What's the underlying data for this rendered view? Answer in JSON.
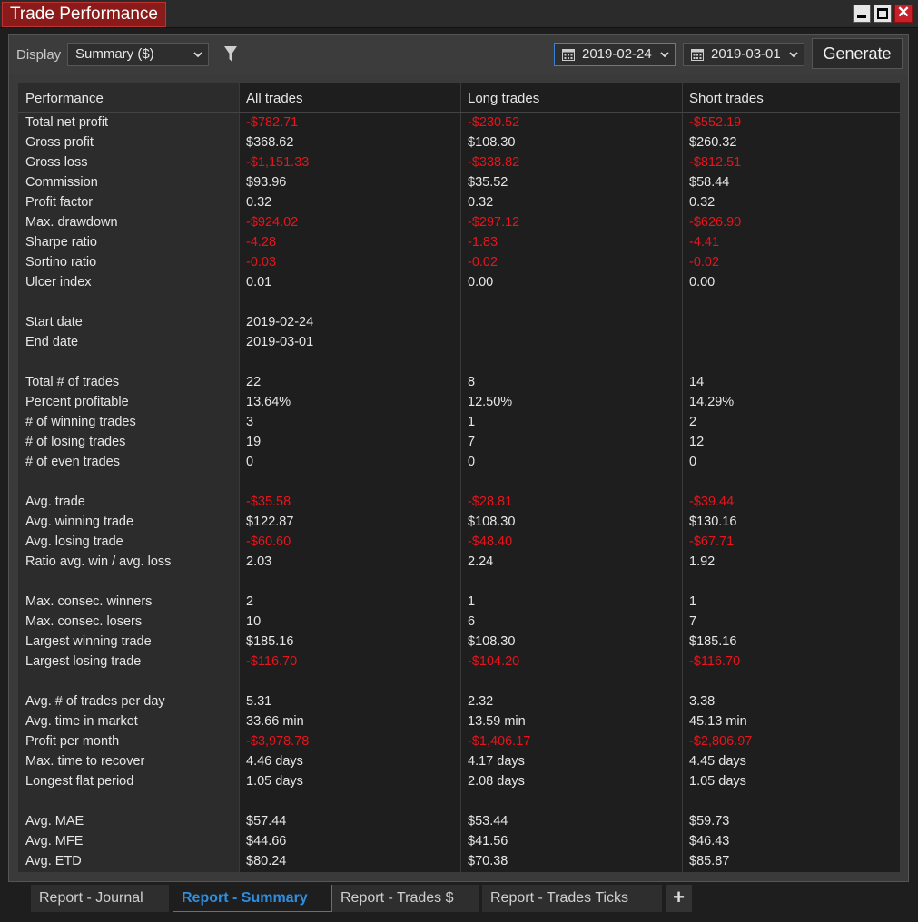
{
  "window": {
    "title": "Trade Performance"
  },
  "toolbar": {
    "display_label": "Display",
    "display_value": "Summary ($)",
    "start_date": "2019-02-24",
    "end_date": "2019-03-01",
    "generate_label": "Generate"
  },
  "table": {
    "headers": [
      "Performance",
      "All trades",
      "Long trades",
      "Short trades"
    ],
    "rows": [
      {
        "label": "Total net profit",
        "all": "-$782.71",
        "long": "-$230.52",
        "short": "-$552.19",
        "neg": true
      },
      {
        "label": "Gross profit",
        "all": "$368.62",
        "long": "$108.30",
        "short": "$260.32",
        "neg": false
      },
      {
        "label": "Gross loss",
        "all": "-$1,151.33",
        "long": "-$338.82",
        "short": "-$812.51",
        "neg": true
      },
      {
        "label": "Commission",
        "all": "$93.96",
        "long": "$35.52",
        "short": "$58.44",
        "neg": false
      },
      {
        "label": "Profit factor",
        "all": "0.32",
        "long": "0.32",
        "short": "0.32",
        "neg": false
      },
      {
        "label": "Max. drawdown",
        "all": "-$924.02",
        "long": "-$297.12",
        "short": "-$626.90",
        "neg": true
      },
      {
        "label": "Sharpe ratio",
        "all": "-4.28",
        "long": "-1.83",
        "short": "-4.41",
        "neg": true
      },
      {
        "label": "Sortino ratio",
        "all": "-0.03",
        "long": "-0.02",
        "short": "-0.02",
        "neg": true
      },
      {
        "label": "Ulcer index",
        "all": "0.01",
        "long": "0.00",
        "short": "0.00",
        "neg": false
      },
      {
        "spacer": true
      },
      {
        "label": "Start date",
        "all": "2019-02-24",
        "long": "",
        "short": "",
        "neg": false
      },
      {
        "label": "End date",
        "all": "2019-03-01",
        "long": "",
        "short": "",
        "neg": false
      },
      {
        "spacer": true
      },
      {
        "label": "Total # of trades",
        "all": "22",
        "long": "8",
        "short": "14",
        "neg": false
      },
      {
        "label": "Percent profitable",
        "all": "13.64%",
        "long": "12.50%",
        "short": "14.29%",
        "neg": false
      },
      {
        "label": "# of winning trades",
        "all": "3",
        "long": "1",
        "short": "2",
        "neg": false
      },
      {
        "label": "# of losing trades",
        "all": "19",
        "long": "7",
        "short": "12",
        "neg": false
      },
      {
        "label": "# of even trades",
        "all": "0",
        "long": "0",
        "short": "0",
        "neg": false
      },
      {
        "spacer": true
      },
      {
        "label": "Avg. trade",
        "all": "-$35.58",
        "long": "-$28.81",
        "short": "-$39.44",
        "neg": true
      },
      {
        "label": "Avg. winning trade",
        "all": "$122.87",
        "long": "$108.30",
        "short": "$130.16",
        "neg": false
      },
      {
        "label": "Avg. losing trade",
        "all": "-$60.60",
        "long": "-$48.40",
        "short": "-$67.71",
        "neg": true
      },
      {
        "label": "Ratio avg. win / avg. loss",
        "all": "2.03",
        "long": "2.24",
        "short": "1.92",
        "neg": false
      },
      {
        "spacer": true
      },
      {
        "label": "Max. consec. winners",
        "all": "2",
        "long": "1",
        "short": "1",
        "neg": false
      },
      {
        "label": "Max. consec. losers",
        "all": "10",
        "long": "6",
        "short": "7",
        "neg": false
      },
      {
        "label": "Largest winning trade",
        "all": "$185.16",
        "long": "$108.30",
        "short": "$185.16",
        "neg": false
      },
      {
        "label": "Largest losing trade",
        "all": "-$116.70",
        "long": "-$104.20",
        "short": "-$116.70",
        "neg": true
      },
      {
        "spacer": true
      },
      {
        "label": "Avg. # of trades per day",
        "all": "5.31",
        "long": "2.32",
        "short": "3.38",
        "neg": false
      },
      {
        "label": "Avg. time in market",
        "all": "33.66 min",
        "long": "13.59 min",
        "short": "45.13 min",
        "neg": false
      },
      {
        "label": "Profit per month",
        "all": "-$3,978.78",
        "long": "-$1,406.17",
        "short": "-$2,806.97",
        "neg": true
      },
      {
        "label": "Max. time to recover",
        "all": "4.46 days",
        "long": "4.17 days",
        "short": "4.45 days",
        "neg": false
      },
      {
        "label": "Longest flat period",
        "all": "1.05 days",
        "long": "2.08 days",
        "short": "1.05 days",
        "neg": false
      },
      {
        "spacer": true
      },
      {
        "label": "Avg. MAE",
        "all": "$57.44",
        "long": "$53.44",
        "short": "$59.73",
        "neg": false
      },
      {
        "label": "Avg. MFE",
        "all": "$44.66",
        "long": "$41.56",
        "short": "$46.43",
        "neg": false
      },
      {
        "label": "Avg. ETD",
        "all": "$80.24",
        "long": "$70.38",
        "short": "$85.87",
        "neg": false
      }
    ]
  },
  "tabs": [
    {
      "label": "Report - Journal",
      "active": false
    },
    {
      "label": "Report - Summary",
      "active": true
    },
    {
      "label": "Report - Trades $",
      "active": false
    },
    {
      "label": "Report - Trades Ticks",
      "active": false
    }
  ],
  "add_tab_label": "+",
  "colors": {
    "negative": "#e8141c",
    "accent": "#2e8ee0",
    "title_bg": "#8b1a1a"
  }
}
